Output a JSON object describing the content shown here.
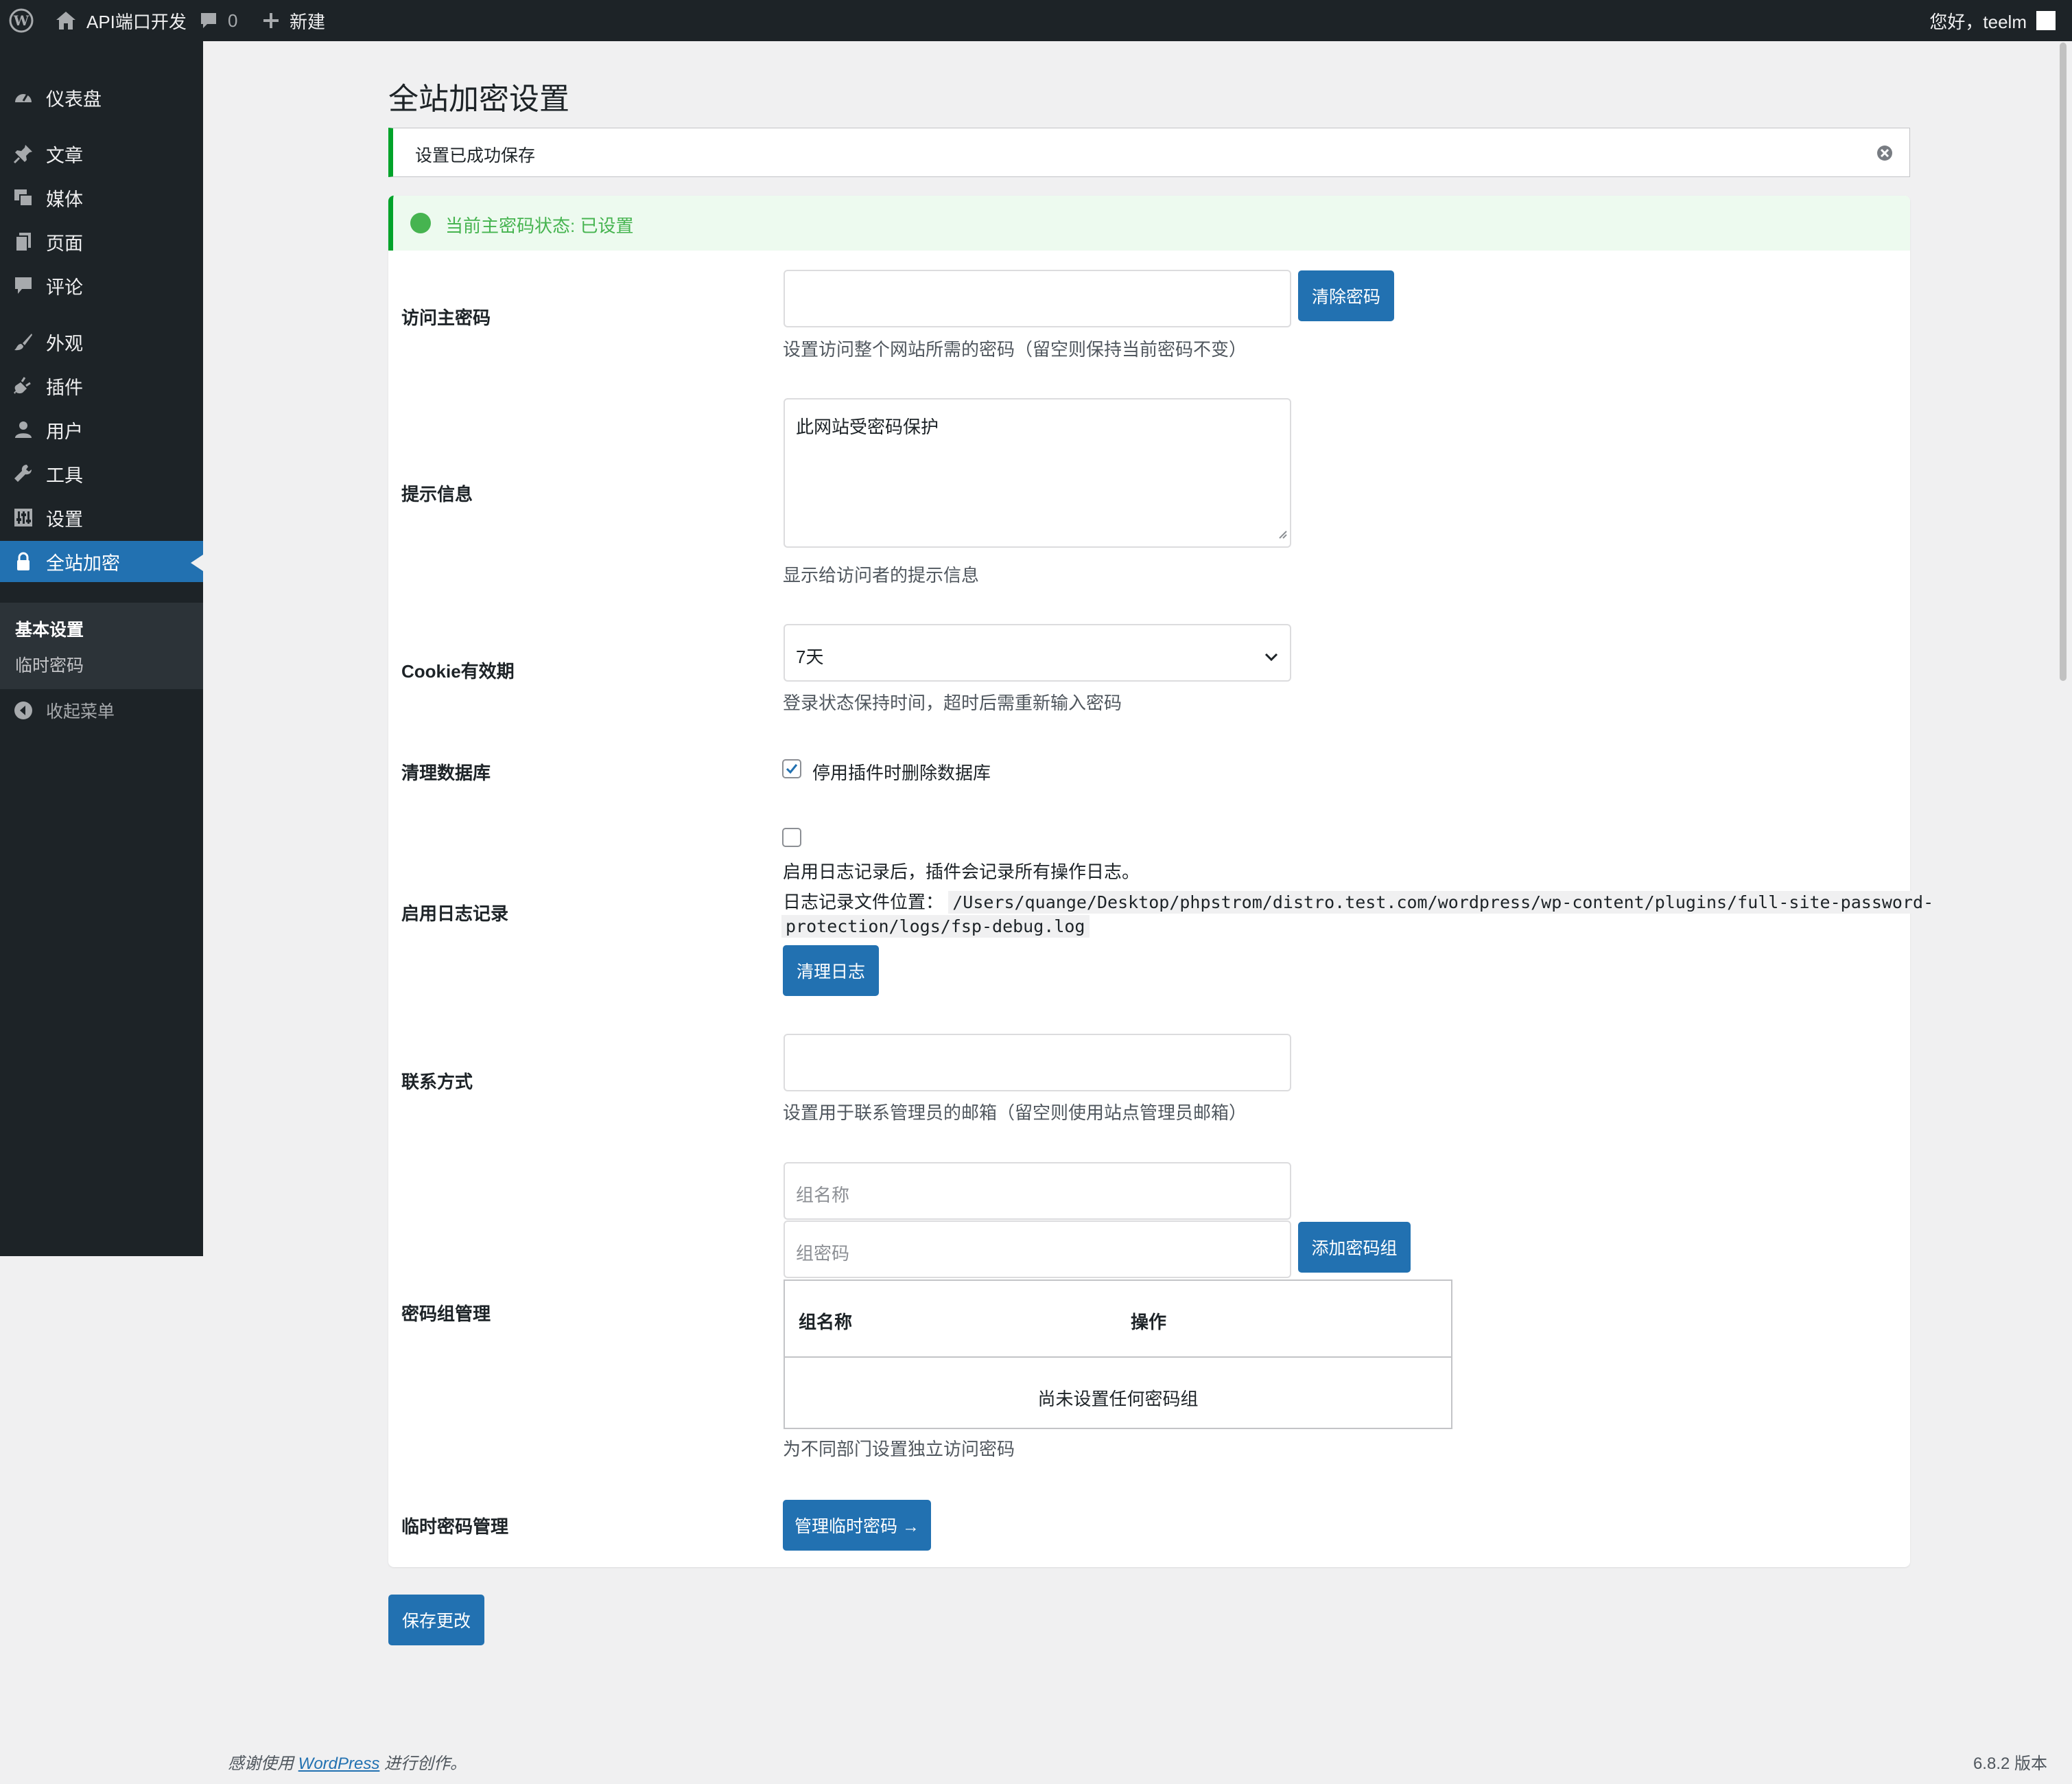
{
  "adminbar": {
    "site_name": "API端口开发",
    "comments_count": "0",
    "new_label": "新建",
    "greeting": "您好，teelm"
  },
  "sidebar": {
    "items": [
      {
        "label": "仪表盘",
        "icon": "dashboard-icon"
      },
      {
        "label": "文章",
        "icon": "pin-icon"
      },
      {
        "label": "媒体",
        "icon": "media-icon"
      },
      {
        "label": "页面",
        "icon": "page-icon"
      },
      {
        "label": "评论",
        "icon": "comment-icon"
      },
      {
        "label": "外观",
        "icon": "brush-icon"
      },
      {
        "label": "插件",
        "icon": "plugin-icon"
      },
      {
        "label": "用户",
        "icon": "user-icon"
      },
      {
        "label": "工具",
        "icon": "wrench-icon"
      },
      {
        "label": "设置",
        "icon": "settings-icon"
      },
      {
        "label": "全站加密",
        "icon": "lock-icon"
      }
    ],
    "submenu": [
      "基本设置",
      "临时密码"
    ],
    "collapse_label": "收起菜单"
  },
  "page": {
    "title": "全站加密设置",
    "notice": "设置已成功保存",
    "status": "当前主密码状态: 已设置"
  },
  "form": {
    "master_password": {
      "label": "访问主密码",
      "value": "",
      "clear_button": "清除密码",
      "desc": "设置访问整个网站所需的密码（留空则保持当前密码不变）"
    },
    "hint": {
      "label": "提示信息",
      "value": "此网站受密码保护",
      "desc": "显示给访问者的提示信息"
    },
    "cookie": {
      "label": "Cookie有效期",
      "selected": "7天",
      "desc": "登录状态保持时间，超时后需重新输入密码"
    },
    "cleanup": {
      "label": "清理数据库",
      "checkbox_label": "停用插件时删除数据库",
      "checked": true
    },
    "logging": {
      "label": "启用日志记录",
      "checked": false,
      "desc": "启用日志记录后，插件会记录所有操作日志。",
      "path_label": "日志记录文件位置：",
      "path_line1": "/Users/quange/Desktop/phpstrom/distro.test.com/wordpress/wp-content/plugins/full-site-password-",
      "path_line2": "protection/logs/fsp-debug.log",
      "clear_button": "清理日志"
    },
    "contact": {
      "label": "联系方式",
      "value": "",
      "desc": "设置用于联系管理员的邮箱（留空则使用站点管理员邮箱）"
    },
    "groups": {
      "label": "密码组管理",
      "name_placeholder": "组名称",
      "password_placeholder": "组密码",
      "add_button": "添加密码组",
      "col_name": "组名称",
      "col_action": "操作",
      "empty": "尚未设置任何密码组",
      "desc": "为不同部门设置独立访问密码"
    },
    "temp": {
      "label": "临时密码管理",
      "button": "管理临时密码 →"
    }
  },
  "save_button": "保存更改",
  "footer": {
    "thanks_prefix": "感谢使用",
    "link": "WordPress",
    "thanks_suffix": "进行创作。",
    "version": "6.8.2 版本"
  },
  "colors": {
    "accent": "#2271b1",
    "success": "#00a32a",
    "status_green": "#46b450",
    "sidebar_bg": "#1d2327"
  }
}
